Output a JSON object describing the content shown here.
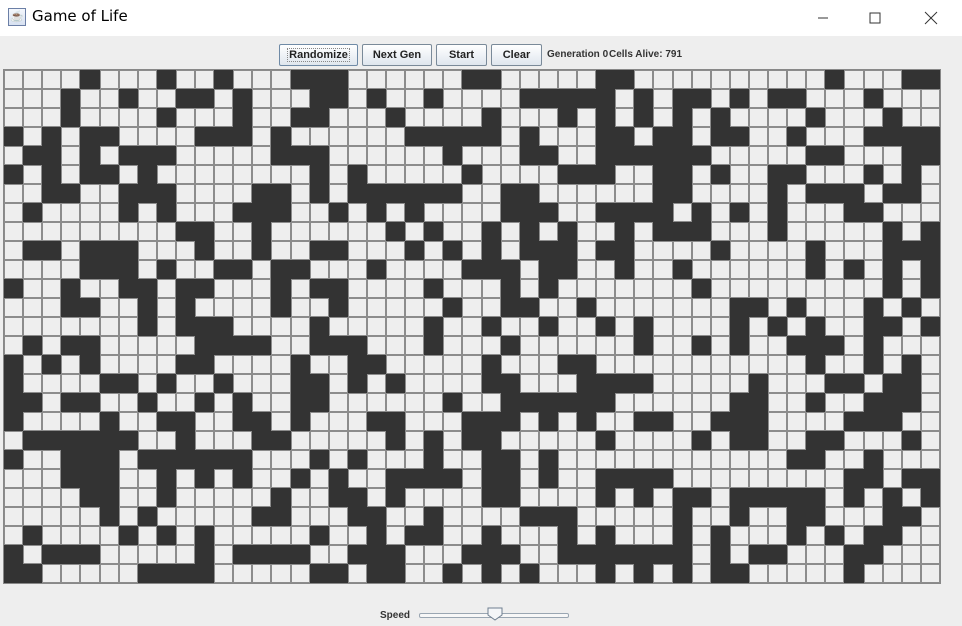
{
  "window": {
    "title": "Game of Life",
    "icon": "java-coffee-icon",
    "controls": [
      "minimize-icon",
      "maximize-icon",
      "close-icon"
    ]
  },
  "toolbar": {
    "randomize_label": "Randomize",
    "next_gen_label": "Next Gen",
    "start_label": "Start",
    "clear_label": "Clear",
    "generation_text": "Generation 0",
    "cells_alive_text": "Cells Alive: 791"
  },
  "grid": {
    "rows": 27,
    "cols": 49,
    "alive_color": "#eeeeee",
    "dead_color": "#333333",
    "seed": 791
  },
  "speed": {
    "label": "Speed",
    "value": 0.52
  }
}
